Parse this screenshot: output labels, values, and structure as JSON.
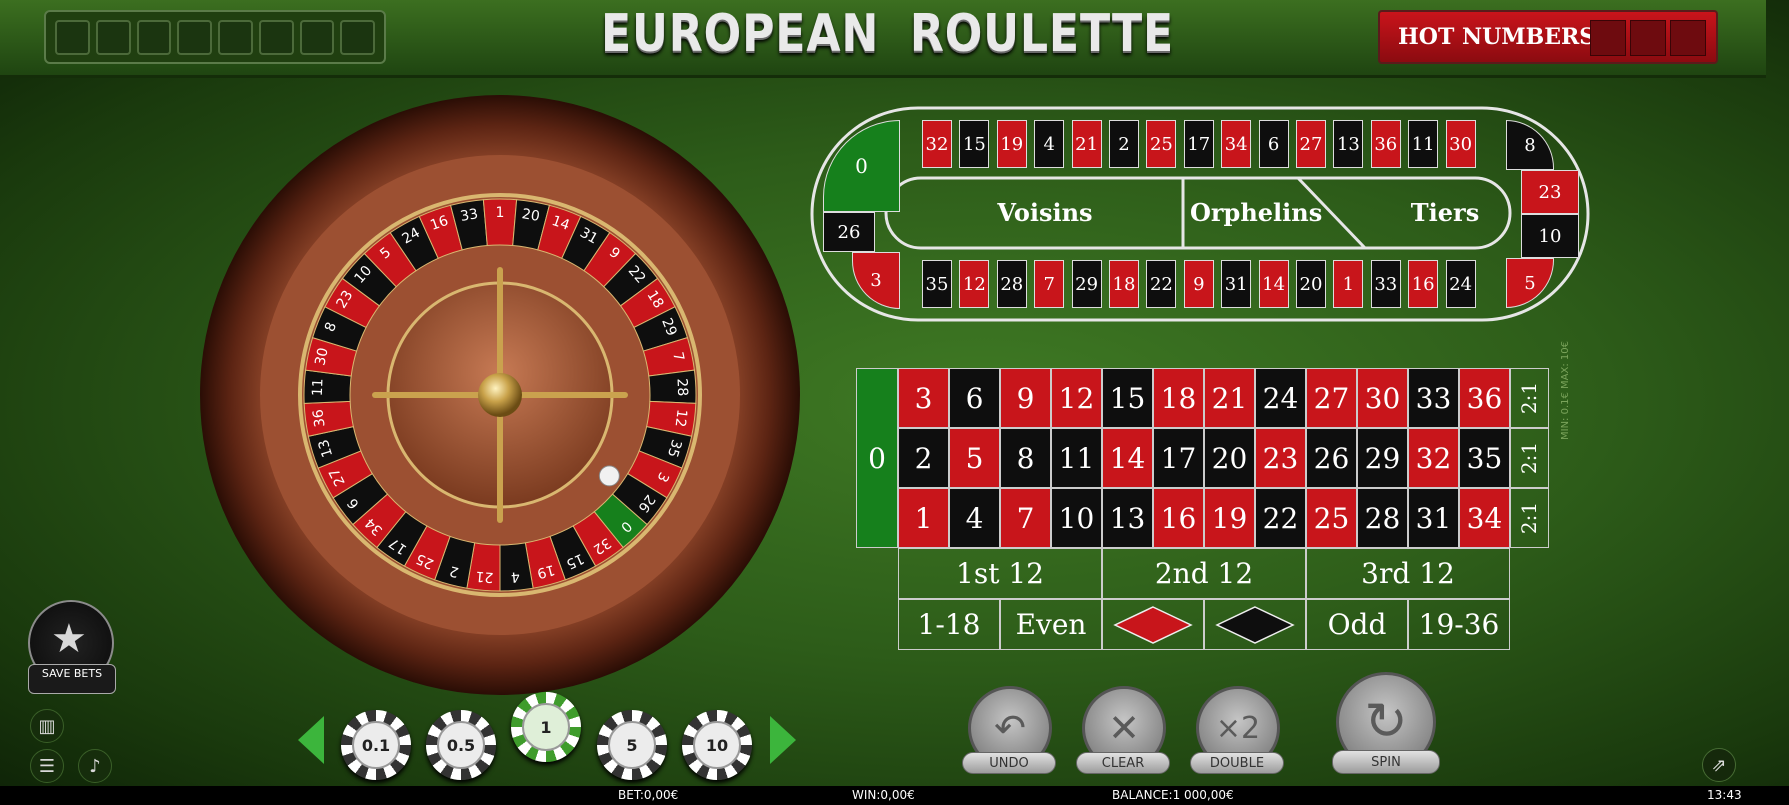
{
  "header": {
    "title_left": "EUROPEAN",
    "title_right": "ROULETTE",
    "hot_numbers_label": "HOT NUMBERS"
  },
  "racetrack": {
    "top_row": [
      "32",
      "15",
      "19",
      "4",
      "21",
      "2",
      "25",
      "17",
      "34",
      "6",
      "27",
      "13",
      "36",
      "11",
      "30"
    ],
    "bottom_row": [
      "35",
      "12",
      "28",
      "7",
      "29",
      "18",
      "22",
      "9",
      "31",
      "14",
      "20",
      "1",
      "33",
      "16",
      "24"
    ],
    "left_zero": "0",
    "left_26": "26",
    "left_3": "3",
    "right": [
      "8",
      "23",
      "10",
      "5"
    ],
    "sections": [
      "Voisins",
      "Orphelins",
      "Tiers"
    ]
  },
  "table": {
    "zero": "0",
    "rows": [
      [
        "3",
        "6",
        "9",
        "12",
        "15",
        "18",
        "21",
        "24",
        "27",
        "30",
        "33",
        "36"
      ],
      [
        "2",
        "5",
        "8",
        "11",
        "14",
        "17",
        "20",
        "23",
        "26",
        "29",
        "32",
        "35"
      ],
      [
        "1",
        "4",
        "7",
        "10",
        "13",
        "16",
        "19",
        "22",
        "25",
        "28",
        "31",
        "34"
      ]
    ],
    "column_bet": "2:1",
    "dozens": [
      "1st 12",
      "2nd 12",
      "3rd 12"
    ],
    "outside": [
      "1-18",
      "Even",
      "",
      "",
      "Odd",
      "19-36"
    ],
    "limits": "MIN: 0.1€   MAX: 10€"
  },
  "wheel": {
    "numbers": [
      "0",
      "32",
      "15",
      "19",
      "4",
      "21",
      "2",
      "25",
      "17",
      "34",
      "6",
      "27",
      "13",
      "36",
      "11",
      "30",
      "8",
      "23",
      "10",
      "5",
      "24",
      "16",
      "33",
      "1",
      "20",
      "14",
      "31",
      "9",
      "22",
      "18",
      "29",
      "7",
      "28",
      "12",
      "35",
      "3",
      "26"
    ]
  },
  "controls": {
    "save_bets": "SAVE BETS",
    "chips": [
      "0.1",
      "0.5",
      "1",
      "5",
      "10"
    ],
    "undo": "UNDO",
    "clear": "CLEAR",
    "double": "DOUBLE",
    "spin": "SPIN"
  },
  "status": {
    "bet": "BET:0,00€",
    "win": "WIN:0,00€",
    "balance": "BALANCE:1 000,00€",
    "time": "13:43"
  },
  "colors": {
    "red": "#c8151b",
    "black": "#0e0e0e",
    "green": "#16801c",
    "felt": "#2d5c19"
  },
  "selected_chip": "1",
  "ball_on_number": "26"
}
